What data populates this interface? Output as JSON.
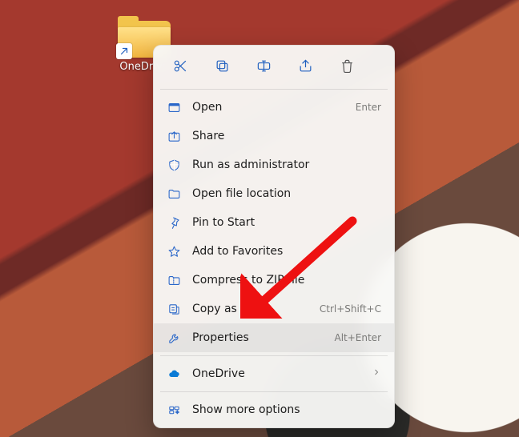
{
  "shortcut": {
    "label": "OneDrive"
  },
  "actions": {
    "cut": "cut",
    "copy": "copy",
    "rename": "rename",
    "share": "share",
    "delete": "delete"
  },
  "menu": {
    "open": {
      "label": "Open",
      "accel": "Enter"
    },
    "share": {
      "label": "Share"
    },
    "runadmin": {
      "label": "Run as administrator"
    },
    "openloc": {
      "label": "Open file location"
    },
    "pin": {
      "label": "Pin to Start"
    },
    "favorites": {
      "label": "Add to Favorites"
    },
    "zip": {
      "label": "Compress to ZIP file"
    },
    "copypath": {
      "label": "Copy as path",
      "accel": "Ctrl+Shift+C"
    },
    "properties": {
      "label": "Properties",
      "accel": "Alt+Enter"
    },
    "onedrive": {
      "label": "OneDrive"
    },
    "more": {
      "label": "Show more options"
    }
  }
}
